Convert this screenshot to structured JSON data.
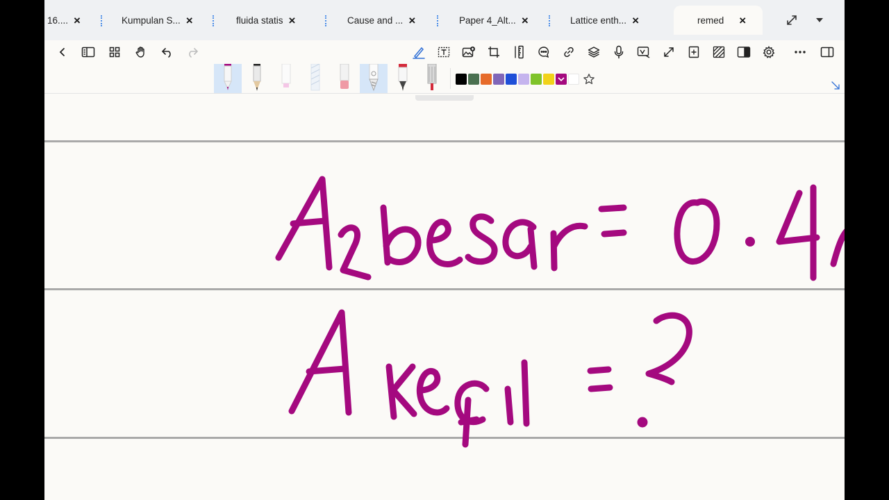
{
  "tabs": [
    {
      "label": "16....",
      "active": false
    },
    {
      "label": "Kumpulan S...",
      "active": false
    },
    {
      "label": "fluida statis",
      "active": false
    },
    {
      "label": "Cause and ...",
      "active": false
    },
    {
      "label": "Paper 4_Alt...",
      "active": false
    },
    {
      "label": "Lattice enth...",
      "active": false
    },
    {
      "label": "remed",
      "active": true
    }
  ],
  "close_glyph": "×",
  "colors": {
    "ink": "#a4097f",
    "accent": "#2f6fd6",
    "palette": [
      "#000000",
      "#4a7050",
      "#e66b2a",
      "#8066b8",
      "#1f4fd8",
      "#c5b4ee",
      "#7fc32a",
      "#f1d21a",
      "#a4097f",
      "#ffffff"
    ]
  },
  "toolbar_icons": [
    "back-icon",
    "sidebar-icon",
    "grid-icon",
    "hand-icon",
    "undo-icon",
    "redo-icon",
    "pen-icon",
    "text-box-icon",
    "image-icon",
    "crop-icon",
    "ruler-icon",
    "comment-icon",
    "link-icon",
    "layers-icon",
    "microphone-icon",
    "read-mode-icon",
    "resize-icon",
    "add-page-icon",
    "pattern-icon",
    "split-view-icon",
    "settings-icon",
    "more-icon",
    "panel-icon"
  ]
}
